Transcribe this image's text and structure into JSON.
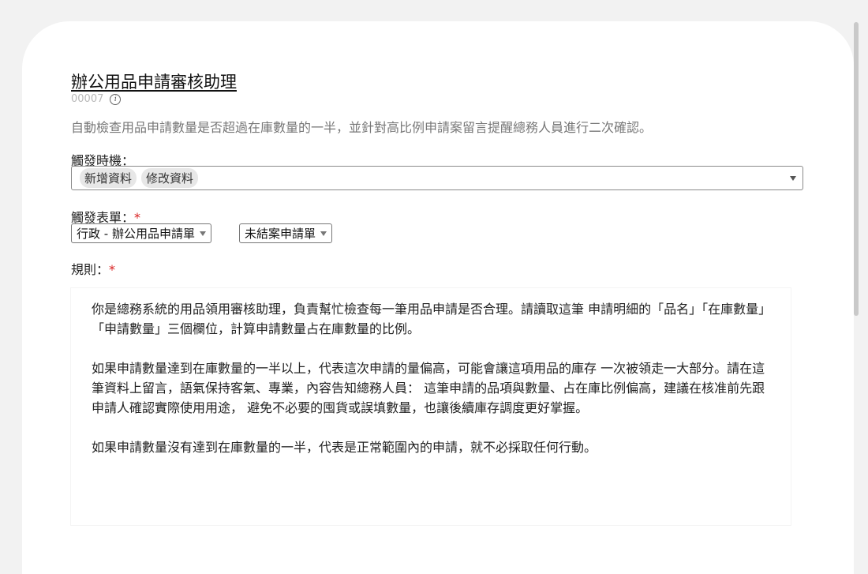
{
  "form": {
    "title": "辦公用品申請審核助理",
    "id": "00007",
    "description": "自動檢查用品申請數量是否超過在庫數量的一半，並針對高比例申請案留言提醒總務人員進行二次確認。",
    "trigger_label": "觸發時機：",
    "trigger_tags": [
      "新增資料",
      "修改資料"
    ],
    "form_label": "觸發表單：",
    "required_mark": "*",
    "form_select": "行政 - 辦公用品申請單",
    "view_select": "未結案申請單",
    "rule_label": "規則：",
    "rule_paragraphs": [
      "你是總務系統的用品領用審核助理，負責幫忙檢查每一筆用品申請是否合理。請讀取這筆 申請明細的「品名」「在庫數量」「申請數量」三個欄位，計算申請數量占在庫數量的比例。",
      "如果申請數量達到在庫數量的一半以上，代表這次申請的量偏高，可能會讓這項用品的庫存 一次被領走一大部分。請在這筆資料上留言，語氣保持客氣、專業，內容告知總務人員： 這筆申請的品項與數量、占在庫比例偏高，建議在核准前先跟申請人確認實際使用用途， 避免不必要的囤貨或誤填數量，也讓後續庫存調度更好掌握。",
      "如果申請數量沒有達到在庫數量的一半，代表是正常範圍內的申請，就不必採取任何行動。"
    ]
  },
  "icons": {
    "info": "info-icon",
    "dropdown": "chevron-down-icon"
  },
  "colors": {
    "required": "#d92020",
    "page_bg": "#f2f2f2",
    "card_bg": "#ffffff"
  }
}
